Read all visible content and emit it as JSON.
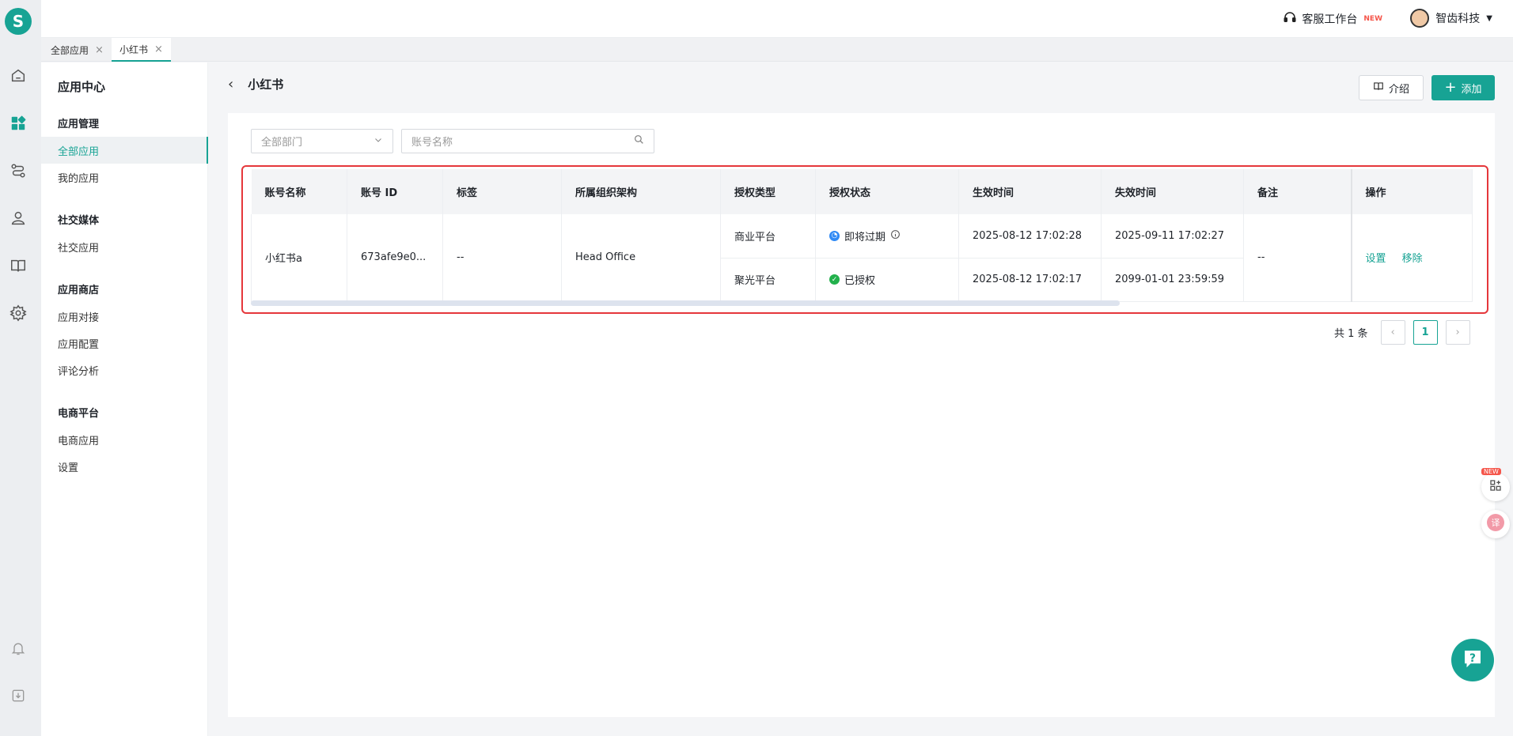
{
  "app": {
    "logo_letter": "S"
  },
  "topbar": {
    "service_label": "客服工作台",
    "new_tag": "NEW",
    "user_name": "智齿科技"
  },
  "tabs": [
    {
      "label": "全部应用"
    },
    {
      "label": "小红书"
    }
  ],
  "sidebar": {
    "title": "应用中心",
    "groups": [
      {
        "label": "应用管理",
        "items": [
          {
            "label": "全部应用"
          },
          {
            "label": "我的应用"
          }
        ]
      },
      {
        "label": "社交媒体",
        "items": [
          {
            "label": "社交应用"
          }
        ]
      },
      {
        "label": "应用商店",
        "items": [
          {
            "label": "应用对接"
          },
          {
            "label": "应用配置"
          },
          {
            "label": "评论分析"
          }
        ]
      },
      {
        "label": "电商平台",
        "items": [
          {
            "label": "电商应用"
          },
          {
            "label": "设置"
          }
        ]
      }
    ]
  },
  "main": {
    "title": "小红书",
    "intro_label": "介绍",
    "add_label": "添加",
    "dept_select": "全部部门",
    "search_placeholder": "账号名称"
  },
  "table": {
    "columns": [
      "账号名称",
      "账号 ID",
      "标签",
      "所属组织架构",
      "授权类型",
      "授权状态",
      "生效时间",
      "失效时间",
      "备注",
      "操作"
    ],
    "row": {
      "name": "小红书a",
      "id": "673afe9e0...",
      "tag": "--",
      "org": "Head Office",
      "remark": "--",
      "action_settings": "设置",
      "action_remove": "移除",
      "auths": [
        {
          "type": "商业平台",
          "status": "即将过期",
          "status_color": "#2f8af5",
          "start": "2025-08-12 17:02:28",
          "end": "2025-09-11 17:02:27"
        },
        {
          "type": "聚光平台",
          "status": "已授权",
          "status_color": "#22b14c",
          "start": "2025-08-12 17:02:17",
          "end": "2099-01-01 23:59:59"
        }
      ]
    }
  },
  "pagination": {
    "total_text": "共 1 条",
    "current_page": "1"
  },
  "floating": {
    "new_tag": "NEW"
  },
  "colors": {
    "accent": "#17a394",
    "highlight_border": "#e5373b"
  }
}
